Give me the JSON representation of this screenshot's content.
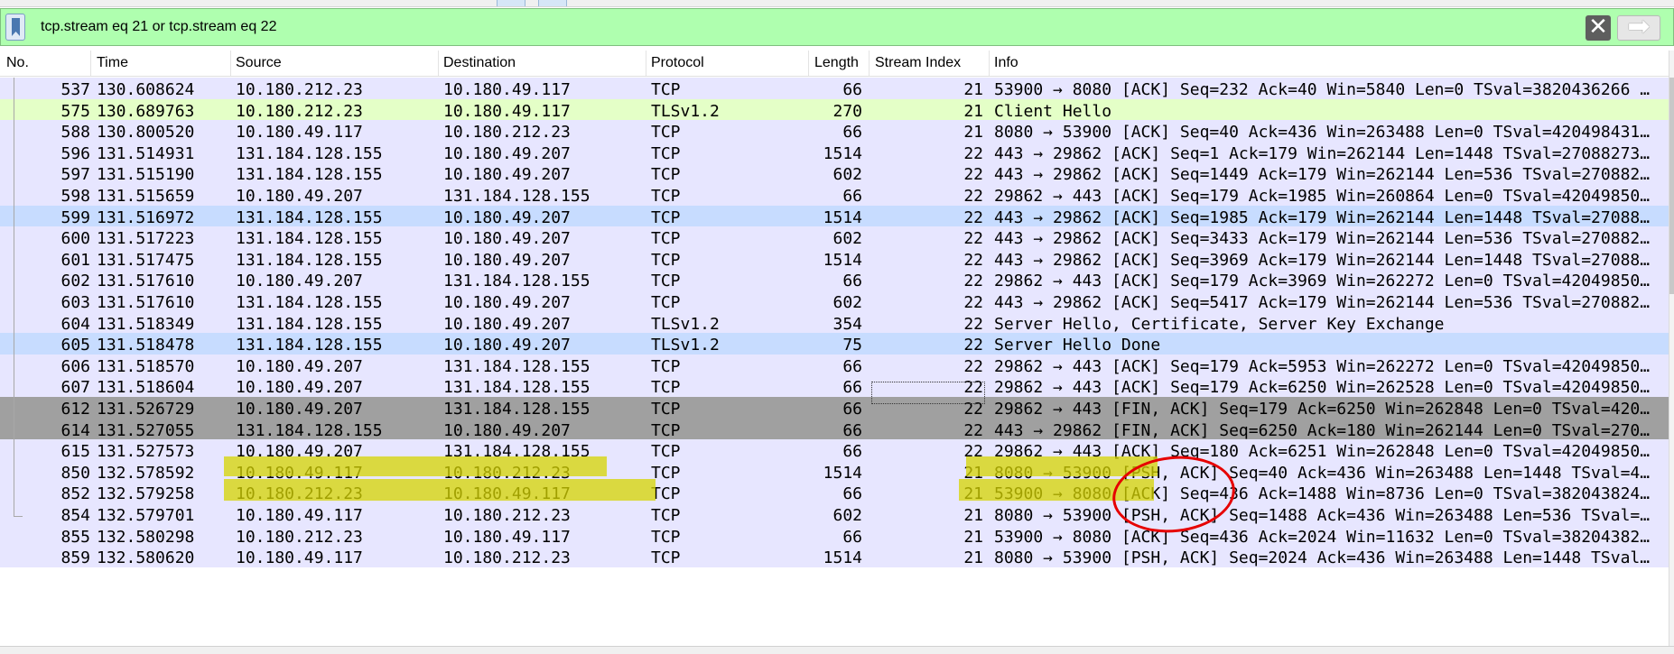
{
  "display_filter": {
    "value": "tcp.stream eq 21 or tcp.stream eq 22",
    "clear_icon": "✕",
    "apply_icon": "➡"
  },
  "columns": [
    "No.",
    "Time",
    "Source",
    "Destination",
    "Protocol",
    "Length",
    "Stream Index",
    "Info"
  ],
  "colors": {
    "tcp_row": "#e7e6ff",
    "tls_row": "#e4ffc7",
    "selected_row": "#c7dcff",
    "marked_row": "#a0a0a0",
    "filter_ok": "#afffaf",
    "highlighter": "#d6d400",
    "annotation_circle": "#e60000"
  },
  "packets": [
    {
      "no": "537",
      "time": "130.608624",
      "src": "10.180.212.23",
      "dst": "10.180.49.117",
      "proto": "TCP",
      "len": "66",
      "stream": "21",
      "info": "53900 → 8080 [ACK] Seq=232 Ack=40 Win=5840 Len=0 TSval=3820436266 …",
      "style": "tcp"
    },
    {
      "no": "575",
      "time": "130.689763",
      "src": "10.180.212.23",
      "dst": "10.180.49.117",
      "proto": "TLSv1.2",
      "len": "270",
      "stream": "21",
      "info": "Client Hello",
      "style": "tls"
    },
    {
      "no": "588",
      "time": "130.800520",
      "src": "10.180.49.117",
      "dst": "10.180.212.23",
      "proto": "TCP",
      "len": "66",
      "stream": "21",
      "info": "8080 → 53900 [ACK] Seq=40 Ack=436 Win=263488 Len=0 TSval=420498431…",
      "style": "tcp"
    },
    {
      "no": "596",
      "time": "131.514931",
      "src": "131.184.128.155",
      "dst": "10.180.49.207",
      "proto": "TCP",
      "len": "1514",
      "stream": "22",
      "info": "443 → 29862 [ACK] Seq=1 Ack=179 Win=262144 Len=1448 TSval=27088273…",
      "style": "tcp"
    },
    {
      "no": "597",
      "time": "131.515190",
      "src": "131.184.128.155",
      "dst": "10.180.49.207",
      "proto": "TCP",
      "len": "602",
      "stream": "22",
      "info": "443 → 29862 [ACK] Seq=1449 Ack=179 Win=262144 Len=536 TSval=270882…",
      "style": "tcp"
    },
    {
      "no": "598",
      "time": "131.515659",
      "src": "10.180.49.207",
      "dst": "131.184.128.155",
      "proto": "TCP",
      "len": "66",
      "stream": "22",
      "info": "29862 → 443 [ACK] Seq=179 Ack=1985 Win=260864 Len=0 TSval=42049850…",
      "style": "tcp"
    },
    {
      "no": "599",
      "time": "131.516972",
      "src": "131.184.128.155",
      "dst": "10.180.49.207",
      "proto": "TCP",
      "len": "1514",
      "stream": "22",
      "info": "443 → 29862 [ACK] Seq=1985 Ack=179 Win=262144 Len=1448 TSval=27088…",
      "style": "selected"
    },
    {
      "no": "600",
      "time": "131.517223",
      "src": "131.184.128.155",
      "dst": "10.180.49.207",
      "proto": "TCP",
      "len": "602",
      "stream": "22",
      "info": "443 → 29862 [ACK] Seq=3433 Ack=179 Win=262144 Len=536 TSval=270882…",
      "style": "tcp"
    },
    {
      "no": "601",
      "time": "131.517475",
      "src": "131.184.128.155",
      "dst": "10.180.49.207",
      "proto": "TCP",
      "len": "1514",
      "stream": "22",
      "info": "443 → 29862 [ACK] Seq=3969 Ack=179 Win=262144 Len=1448 TSval=27088…",
      "style": "tcp"
    },
    {
      "no": "602",
      "time": "131.517610",
      "src": "10.180.49.207",
      "dst": "131.184.128.155",
      "proto": "TCP",
      "len": "66",
      "stream": "22",
      "info": "29862 → 443 [ACK] Seq=179 Ack=3969 Win=262272 Len=0 TSval=42049850…",
      "style": "tcp"
    },
    {
      "no": "603",
      "time": "131.517610",
      "src": "131.184.128.155",
      "dst": "10.180.49.207",
      "proto": "TCP",
      "len": "602",
      "stream": "22",
      "info": "443 → 29862 [ACK] Seq=5417 Ack=179 Win=262144 Len=536 TSval=270882…",
      "style": "tcp"
    },
    {
      "no": "604",
      "time": "131.518349",
      "src": "131.184.128.155",
      "dst": "10.180.49.207",
      "proto": "TLSv1.2",
      "len": "354",
      "stream": "22",
      "info": "Server Hello, Certificate, Server Key Exchange",
      "style": "tcp"
    },
    {
      "no": "605",
      "time": "131.518478",
      "src": "131.184.128.155",
      "dst": "10.180.49.207",
      "proto": "TLSv1.2",
      "len": "75",
      "stream": "22",
      "info": "Server Hello Done",
      "style": "selected"
    },
    {
      "no": "606",
      "time": "131.518570",
      "src": "10.180.49.207",
      "dst": "131.184.128.155",
      "proto": "TCP",
      "len": "66",
      "stream": "22",
      "info": "29862 → 443 [ACK] Seq=179 Ack=5953 Win=262272 Len=0 TSval=42049850…",
      "style": "tcp"
    },
    {
      "no": "607",
      "time": "131.518604",
      "src": "10.180.49.207",
      "dst": "131.184.128.155",
      "proto": "TCP",
      "len": "66",
      "stream": "22",
      "info": "29862 → 443 [ACK] Seq=179 Ack=6250 Win=262528 Len=0 TSval=42049850…",
      "style": "tcp"
    },
    {
      "no": "612",
      "time": "131.526729",
      "src": "10.180.49.207",
      "dst": "131.184.128.155",
      "proto": "TCP",
      "len": "66",
      "stream": "22",
      "info": "29862 → 443 [FIN, ACK] Seq=179 Ack=6250 Win=262848 Len=0 TSval=420…",
      "style": "marked"
    },
    {
      "no": "614",
      "time": "131.527055",
      "src": "131.184.128.155",
      "dst": "10.180.49.207",
      "proto": "TCP",
      "len": "66",
      "stream": "22",
      "info": "443 → 29862 [FIN, ACK] Seq=6250 Ack=180 Win=262144 Len=0 TSval=270…",
      "style": "marked"
    },
    {
      "no": "615",
      "time": "131.527573",
      "src": "10.180.49.207",
      "dst": "131.184.128.155",
      "proto": "TCP",
      "len": "66",
      "stream": "22",
      "info": "29862 → 443 [ACK] Seq=180 Ack=6251 Win=262848 Len=0 TSval=42049850…",
      "style": "tcp"
    },
    {
      "no": "850",
      "time": "132.578592",
      "src": "10.180.49.117",
      "dst": "10.180.212.23",
      "proto": "TCP",
      "len": "1514",
      "stream": "21",
      "info": "8080 → 53900 [PSH, ACK] Seq=40 Ack=436 Win=263488 Len=1448 TSval=4…",
      "style": "tcp"
    },
    {
      "no": "852",
      "time": "132.579258",
      "src": "10.180.212.23",
      "dst": "10.180.49.117",
      "proto": "TCP",
      "len": "66",
      "stream": "21",
      "info": "53900 → 8080 [ACK] Seq=436 Ack=1488 Win=8736 Len=0 TSval=382043824…",
      "style": "tcp"
    },
    {
      "no": "854",
      "time": "132.579701",
      "src": "10.180.49.117",
      "dst": "10.180.212.23",
      "proto": "TCP",
      "len": "602",
      "stream": "21",
      "info": "8080 → 53900 [PSH, ACK] Seq=1488 Ack=436 Win=263488 Len=536 TSval=…",
      "style": "tcp"
    },
    {
      "no": "855",
      "time": "132.580298",
      "src": "10.180.212.23",
      "dst": "10.180.49.117",
      "proto": "TCP",
      "len": "66",
      "stream": "21",
      "info": "53900 → 8080 [ACK] Seq=436 Ack=2024 Win=11632 Len=0 TSval=38204382…",
      "style": "tcp"
    },
    {
      "no": "859",
      "time": "132.580620",
      "src": "10.180.49.117",
      "dst": "10.180.212.23",
      "proto": "TCP",
      "len": "1514",
      "stream": "21",
      "info": "8080 → 53900 [PSH, ACK] Seq=2024 Ack=436 Win=263488 Len=1448 TSval…",
      "style": "tcp"
    }
  ]
}
